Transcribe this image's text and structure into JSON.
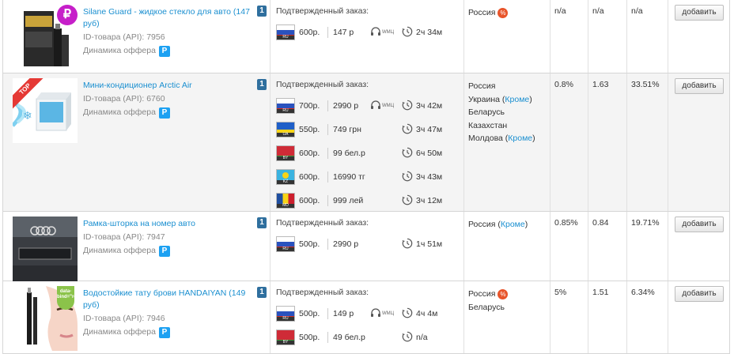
{
  "common": {
    "order_label": "Подтвержденный заказ:",
    "id_label": "ID-товара (API):",
    "dynamics_label": "Динамика оффера",
    "dynamics_badge": "P",
    "add_label": "добавить",
    "pct_badge": "%"
  },
  "rows": [
    {
      "title": "Silane Guard - жидкое стекло для авто (147 руб)",
      "id": "7956",
      "qty_badge": "1",
      "thumb_badge": "₽",
      "orders": [
        {
          "flag": "ru",
          "code": "RU",
          "price": "600р.",
          "local": "147 р",
          "callcenter": "WMЦ",
          "time": "2ч 34м"
        }
      ],
      "geo": [
        {
          "name": "Россия",
          "extra": "",
          "pct": true
        }
      ],
      "m1": "n/a",
      "m2": "n/a",
      "m3": "n/a"
    },
    {
      "title": "Мини-кондиционер Arctic Air",
      "id": "6760",
      "qty_badge": "1",
      "thumb_badge": "TOP",
      "orders": [
        {
          "flag": "ru",
          "code": "RU",
          "price": "700р.",
          "local": "2990 р",
          "callcenter": "WMЦ",
          "time": "3ч 42м"
        },
        {
          "flag": "ua",
          "code": "UA",
          "price": "550р.",
          "local": "749 грн",
          "callcenter": "",
          "time": "3ч 47м"
        },
        {
          "flag": "by",
          "code": "BY",
          "price": "600р.",
          "local": "99 бел.р",
          "callcenter": "",
          "time": "6ч 50м"
        },
        {
          "flag": "kz",
          "code": "KZ",
          "price": "600р.",
          "local": "16990 тг",
          "callcenter": "",
          "time": "3ч 43м"
        },
        {
          "flag": "md",
          "code": "MD",
          "price": "600р.",
          "local": "999 лей",
          "callcenter": "",
          "time": "3ч 12м"
        }
      ],
      "geo": [
        {
          "name": "Россия",
          "extra": "",
          "pct": false
        },
        {
          "name": "Украина",
          "extra": "Кроме",
          "pct": false
        },
        {
          "name": "Беларусь",
          "extra": "",
          "pct": false
        },
        {
          "name": "Казахстан",
          "extra": "",
          "pct": false
        },
        {
          "name": "Молдова",
          "extra": "Кроме",
          "pct": false
        }
      ],
      "m1": "0.8%",
      "m2": "1.63",
      "m3": "33.51%"
    },
    {
      "title": "Рамка-шторка на номер авто",
      "id": "7947",
      "qty_badge": "1",
      "thumb_badge": "",
      "orders": [
        {
          "flag": "ru",
          "code": "RU",
          "price": "500р.",
          "local": "2990 р",
          "callcenter": "",
          "time": "1ч 51м"
        }
      ],
      "geo": [
        {
          "name": "Россия",
          "extra": "Кроме",
          "pct": false
        }
      ],
      "m1": "0.85%",
      "m2": "0.84",
      "m3": "19.71%"
    },
    {
      "title": "Водостойкие тату брови HANDAIYAN (149 руб)",
      "id": "7946",
      "qty_badge": "1",
      "thumb_badge": "LOW PRICE",
      "orders": [
        {
          "flag": "ru",
          "code": "RU",
          "price": "500р.",
          "local": "149 р",
          "callcenter": "WMЦ",
          "time": "4ч 4м"
        },
        {
          "flag": "by",
          "code": "BY",
          "price": "500р.",
          "local": "49 бел.р",
          "callcenter": "",
          "time": "n/a"
        }
      ],
      "geo": [
        {
          "name": "Россия",
          "extra": "",
          "pct": true
        },
        {
          "name": "Беларусь",
          "extra": "",
          "pct": false
        }
      ],
      "m1": "5%",
      "m2": "1.51",
      "m3": "6.34%"
    }
  ]
}
